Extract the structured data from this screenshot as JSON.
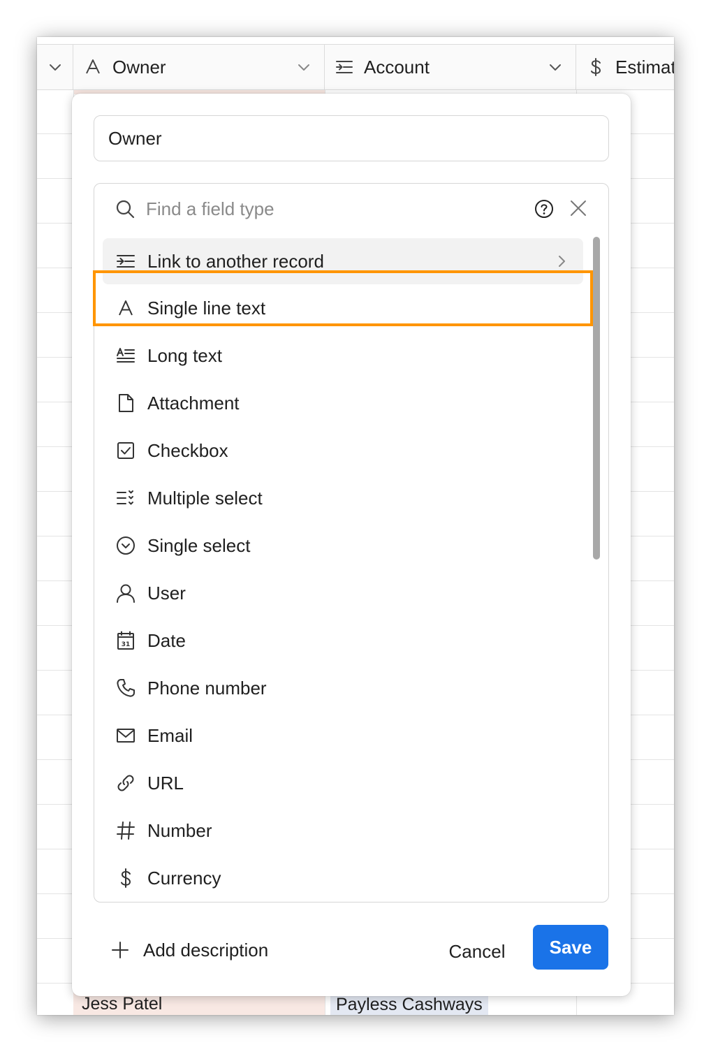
{
  "grid": {
    "columns": [
      {
        "label": "Owner",
        "icon": "single-line-text-icon"
      },
      {
        "label": "Account",
        "icon": "link-record-icon"
      },
      {
        "label": "Estimat",
        "icon": "currency-icon"
      }
    ],
    "bottom_row": {
      "owner": "Jess Patel",
      "account": "Payless Cashways"
    }
  },
  "dialog": {
    "field_name": "Owner",
    "search_placeholder": "Find a field type",
    "field_types": [
      {
        "label": "Link to another record",
        "icon": "link-record-icon",
        "selected": true
      },
      {
        "label": "Single line text",
        "icon": "single-line-text-icon"
      },
      {
        "label": "Long text",
        "icon": "long-text-icon"
      },
      {
        "label": "Attachment",
        "icon": "attachment-icon"
      },
      {
        "label": "Checkbox",
        "icon": "checkbox-icon"
      },
      {
        "label": "Multiple select",
        "icon": "multiple-select-icon"
      },
      {
        "label": "Single select",
        "icon": "single-select-icon"
      },
      {
        "label": "User",
        "icon": "user-icon"
      },
      {
        "label": "Date",
        "icon": "date-icon"
      },
      {
        "label": "Phone number",
        "icon": "phone-icon"
      },
      {
        "label": "Email",
        "icon": "email-icon"
      },
      {
        "label": "URL",
        "icon": "url-icon"
      },
      {
        "label": "Number",
        "icon": "number-icon"
      },
      {
        "label": "Currency",
        "icon": "currency-icon"
      }
    ],
    "add_description": "Add description",
    "cancel_label": "Cancel",
    "save_label": "Save"
  },
  "colors": {
    "accent": "#1a73e8",
    "highlight": "#ff9500",
    "selected_bg": "#f2f2f2"
  }
}
